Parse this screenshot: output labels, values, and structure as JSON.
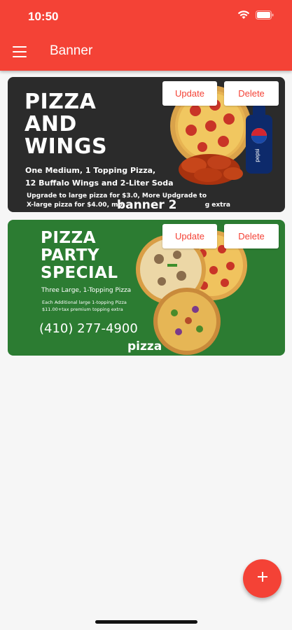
{
  "status_bar": {
    "time": "10:50"
  },
  "header": {
    "title": "Banner"
  },
  "banners": [
    {
      "name": "banner 2",
      "headline": [
        "PIZZA",
        "AND",
        "WINGS"
      ],
      "details": [
        "One Medium, 1 Topping Pizza,",
        "12 Buffalo Wings and 2-Liter Soda"
      ],
      "fine_print": [
        "Upgrade to large pizza for $3.0, More Updgrade to",
        "X-large pizza for $4.00, mo",
        "g extra"
      ],
      "drink_label": "pepsi",
      "update_label": "Update",
      "delete_label": "Delete"
    },
    {
      "name": "pizza",
      "headline": [
        "PIZZA",
        "PARTY",
        "SPECIAL"
      ],
      "details": [
        "Three Large, 1-Topping Pizza"
      ],
      "fine_print": [
        "Each Additional large  1-topping Pizza",
        "$11.00+tax  premium topping extra"
      ],
      "phone": "(410) 277-4900",
      "update_label": "Update",
      "delete_label": "Delete"
    }
  ],
  "fab": {
    "icon": "plus-icon",
    "label": "+"
  },
  "colors": {
    "primary": "#f44236",
    "banner1_bg": "#2b2b2b",
    "banner2_bg": "#2c7c32",
    "background": "#f6f6f6"
  }
}
